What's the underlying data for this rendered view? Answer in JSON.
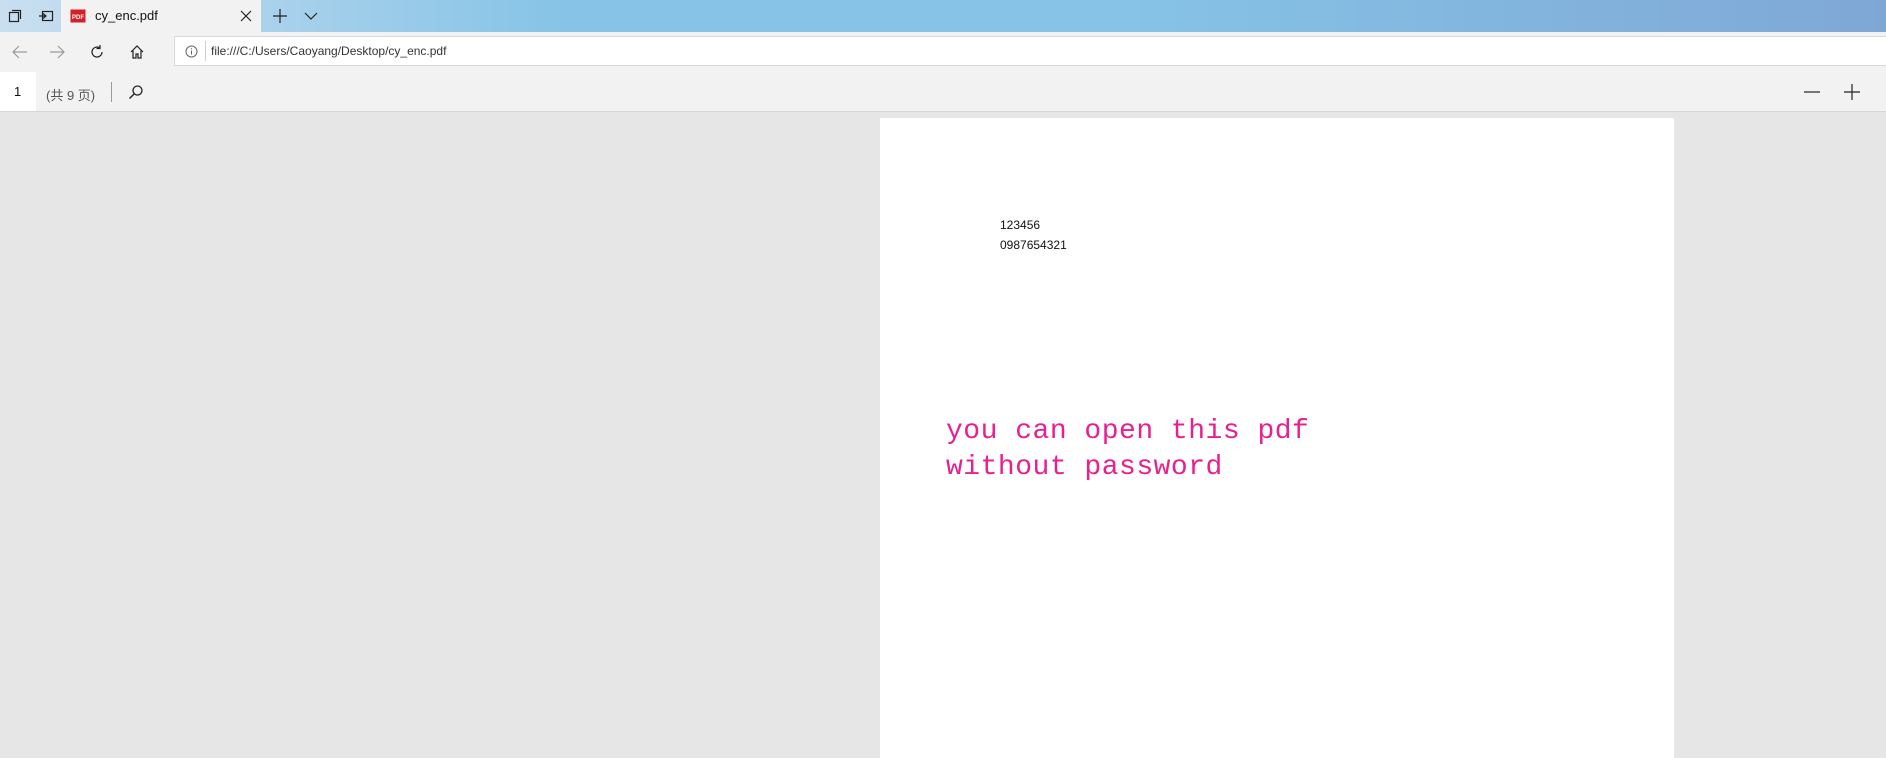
{
  "tab": {
    "title": "cy_enc.pdf",
    "favicon": "pdf-file-icon"
  },
  "titlebar": {
    "icons": [
      "tabs-aside-icon",
      "set-tabs-aside-icon",
      "close-icon",
      "plus-icon",
      "chevron-down-icon"
    ]
  },
  "nav": {
    "icons": [
      "back-arrow-icon",
      "forward-arrow-icon",
      "refresh-icon",
      "home-icon"
    ],
    "address": {
      "info_icon": "info-icon",
      "url": "file:///C:/Users/Caoyang/Desktop/cy_enc.pdf"
    }
  },
  "pdf_toolbar": {
    "page_number": "1",
    "page_total": "(共 9 页)",
    "icons": [
      "search-icon",
      "zoom-out-icon",
      "zoom-in-icon"
    ]
  },
  "document": {
    "lines": [
      "123456",
      "0987654321"
    ],
    "watermark_lines": [
      "you can open this pdf",
      "without password"
    ]
  },
  "colors": {
    "pink_text": "#e8208f",
    "viewer_bg": "#e6e6e6",
    "toolbar_bg": "#f2f2f2"
  }
}
